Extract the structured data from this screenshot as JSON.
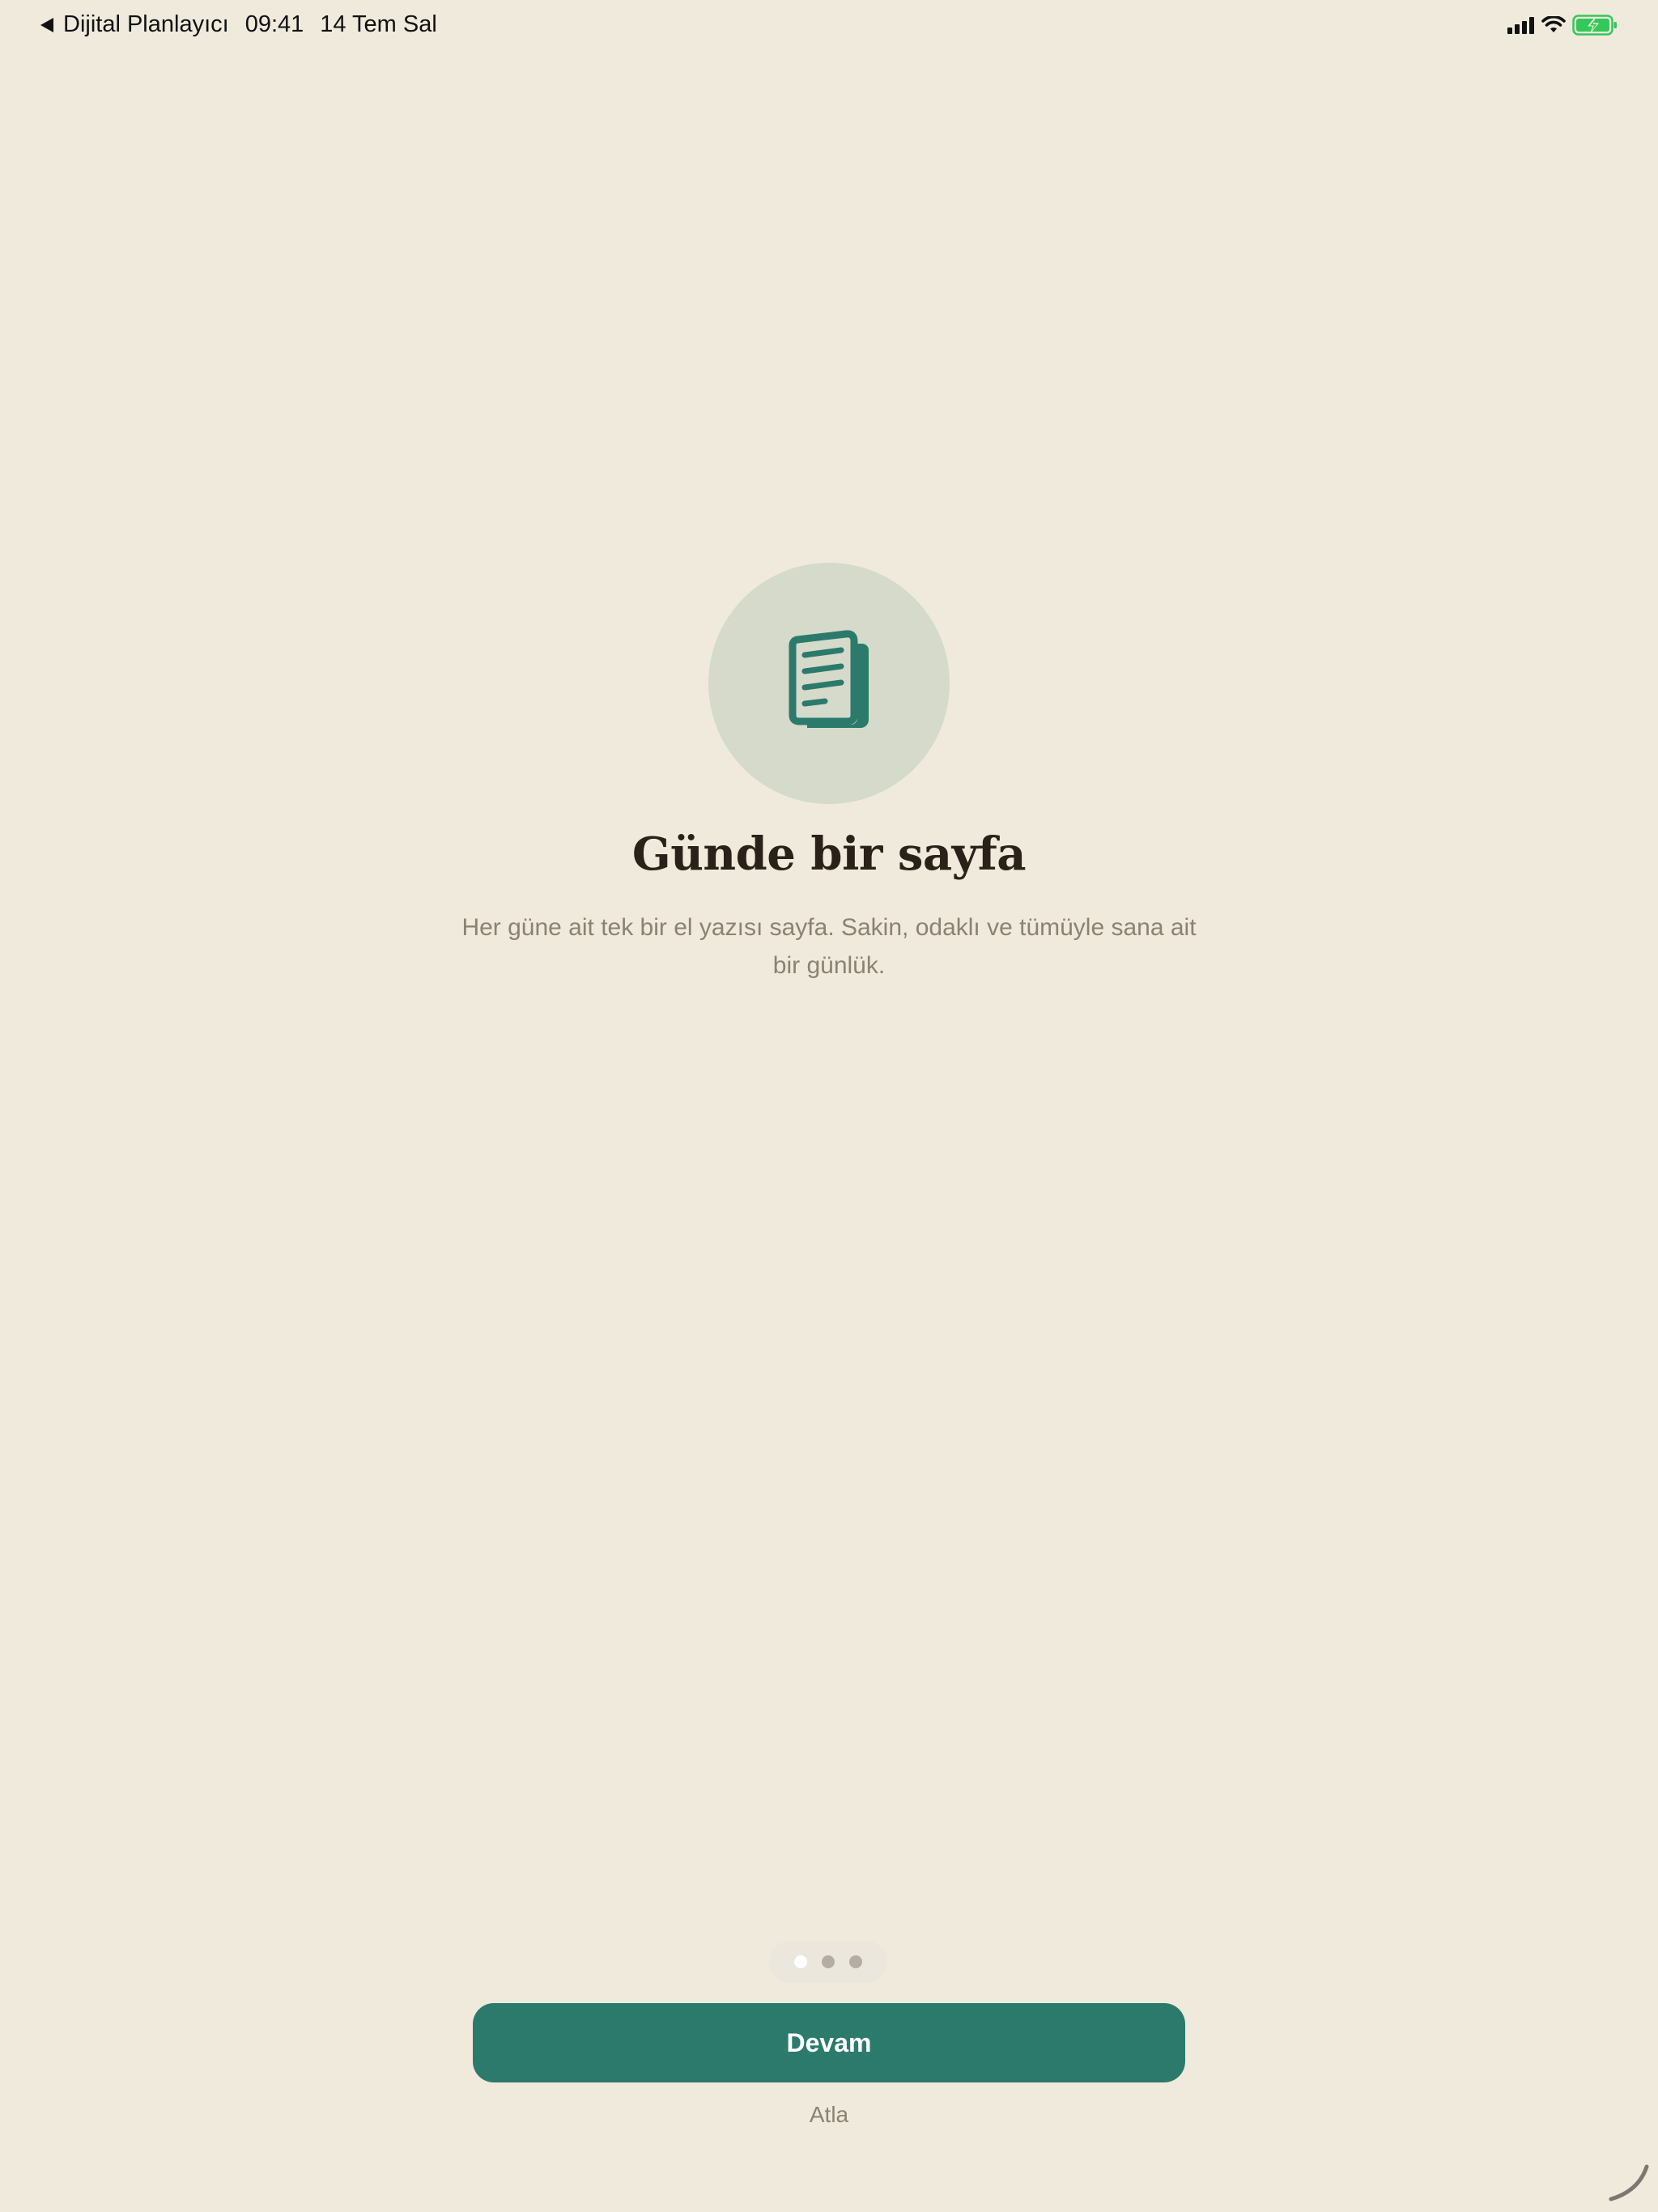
{
  "status_bar": {
    "back_app": "Dijital Planlayıcı",
    "time": "09:41",
    "date": "14 Tem Sal",
    "battery_color": "#34C759"
  },
  "hero": {
    "icon": "document-pages-icon",
    "title": "Günde bir sayfa",
    "subtitle": "Her güne ait tek bir el yazısı sayfa. Sakin, odaklı ve tümüyle sana ait bir günlük."
  },
  "pager": {
    "total": 3,
    "active_index": 0
  },
  "actions": {
    "continue_label": "Devam",
    "skip_label": "Atla"
  },
  "colors": {
    "background": "#F0EADD",
    "accent": "#2C7A6C",
    "icon_circle": "#D5DACB",
    "title": "#2A2118",
    "muted_text": "#8B8272"
  }
}
